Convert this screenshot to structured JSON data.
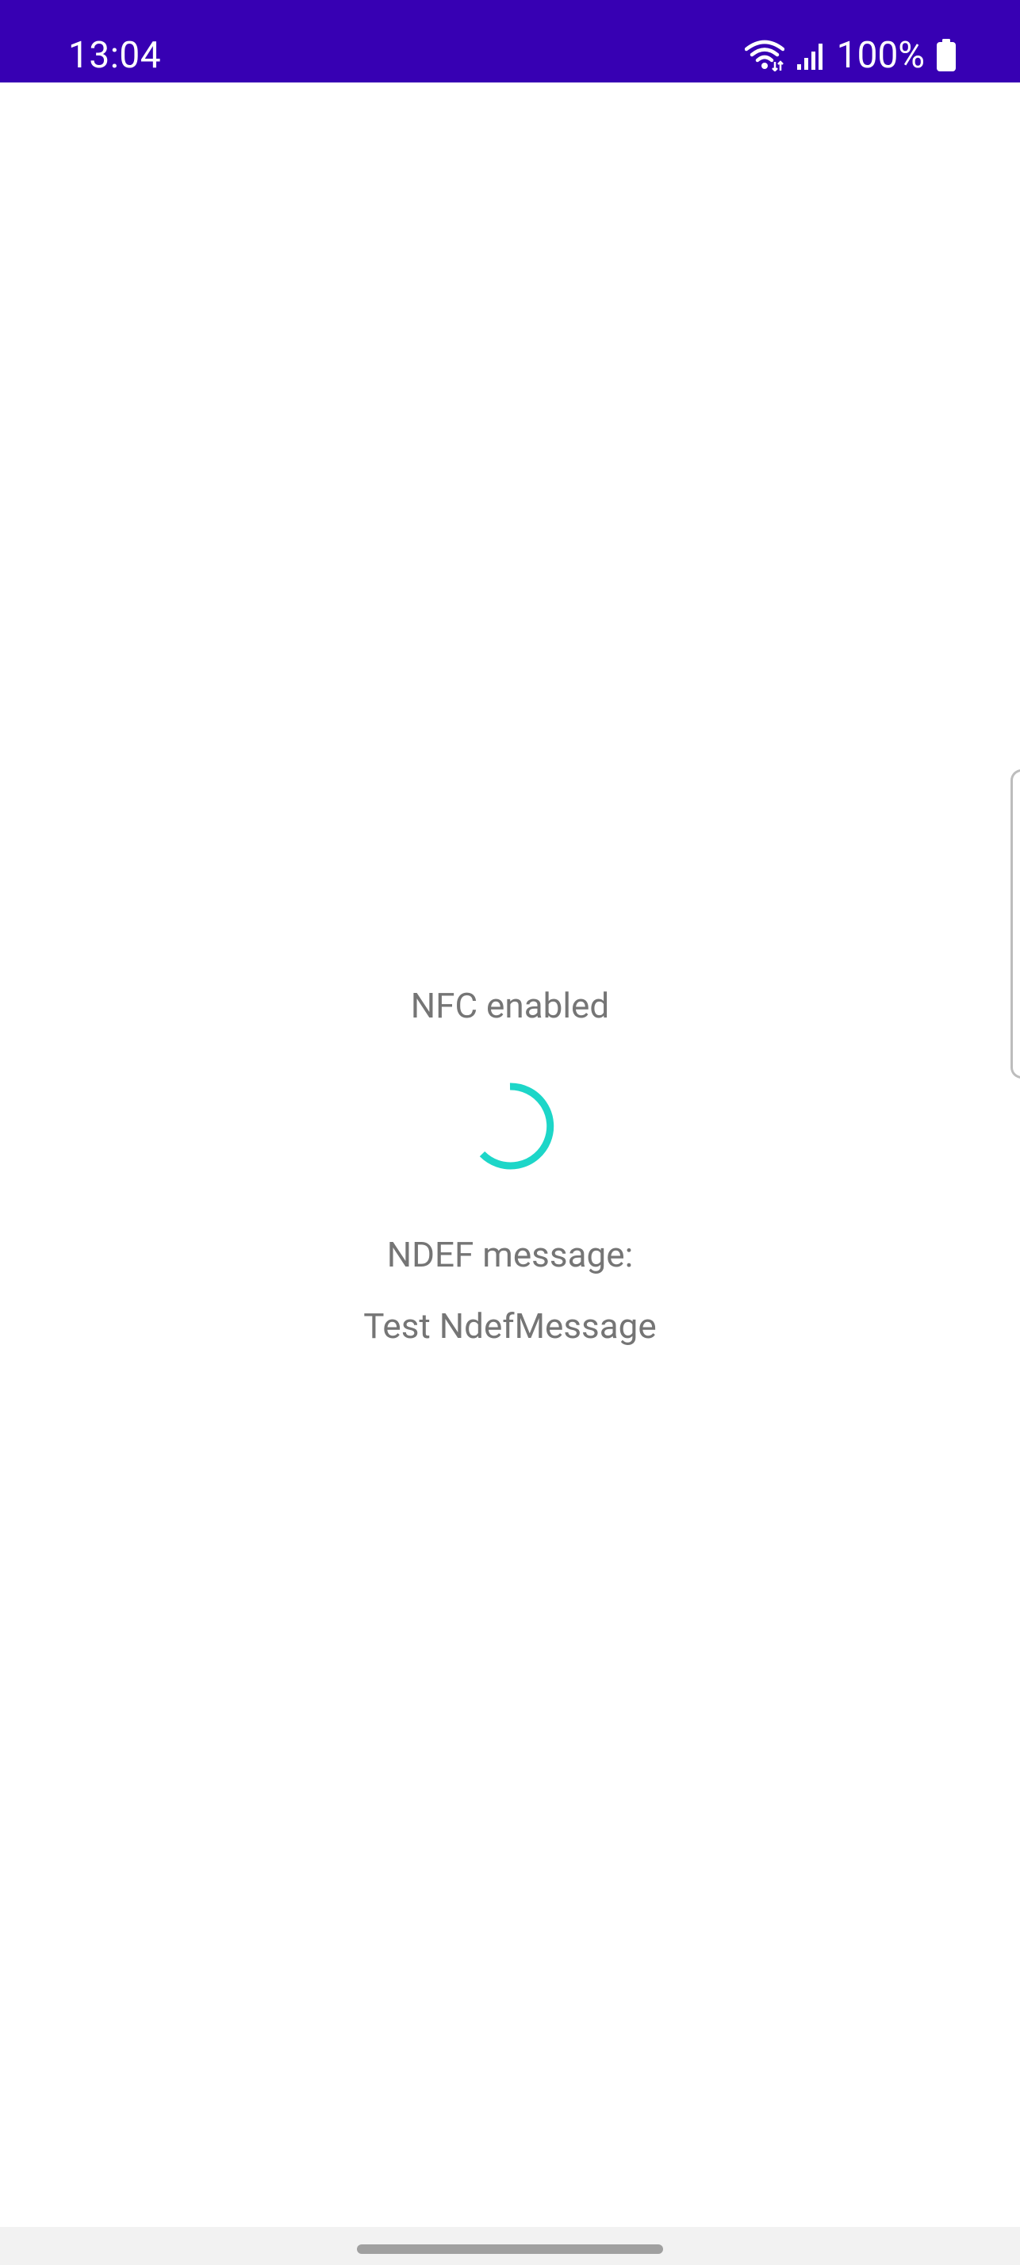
{
  "status_bar": {
    "time": "13:04",
    "battery_percent": "100%",
    "icons": [
      "wifi-icon",
      "cellular-signal-icon",
      "battery-icon"
    ],
    "background_color": "#3700b3"
  },
  "main": {
    "nfc_status": "NFC enabled",
    "ndef_label": "NDEF message:",
    "ndef_message": "Test NdefMessage",
    "spinner_color": "#1dd6c8",
    "text_color": "#757575"
  },
  "navigation": {
    "home_handle": "home-gesture-handle"
  }
}
